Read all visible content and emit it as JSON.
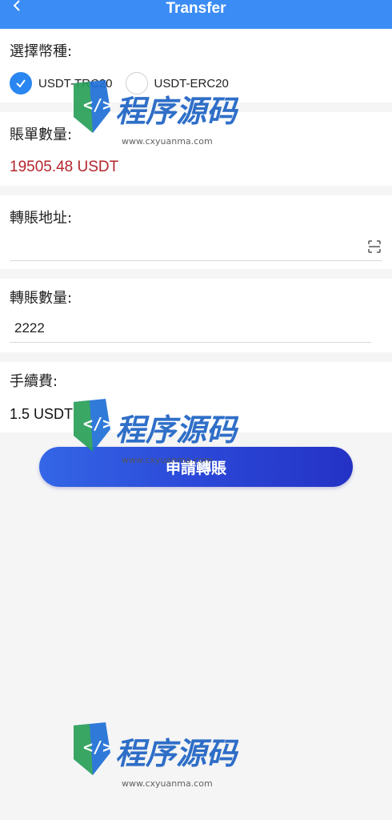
{
  "header": {
    "back_icon": "chevron-left-icon",
    "title": "Transfer",
    "background": "#3b8cf5"
  },
  "currency": {
    "label": "選擇幣種:",
    "options": [
      {
        "label": "USDT-TRC20",
        "checked": true
      },
      {
        "label": "USDT-ERC20",
        "checked": false
      }
    ],
    "accent": "#2a86f0"
  },
  "balance": {
    "label": "賬單數量:",
    "value": "19505.48 USDT",
    "color": "#b3262c"
  },
  "address": {
    "label": "轉賬地址:",
    "value": "",
    "placeholder": "",
    "scan_icon": "scan-icon"
  },
  "amount": {
    "label": "轉賬數量:",
    "value": "2222"
  },
  "fee": {
    "label": "手續費:",
    "value": "1.5 USDT"
  },
  "submit": {
    "label": "申請轉賬"
  },
  "watermark": {
    "name": "程序源码网",
    "url": "www.cxyuanma.com"
  }
}
